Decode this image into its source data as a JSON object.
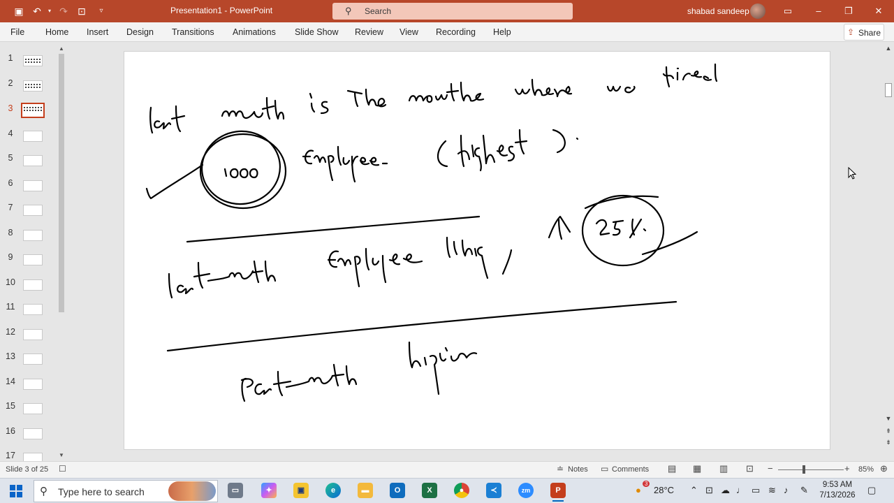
{
  "titlebar": {
    "doc_title": "Presentation1  -  PowerPoint",
    "search_placeholder": "Search",
    "user_name": "shabad sandeep",
    "icons": [
      "save-icon",
      "undo-icon",
      "redo-icon",
      "present-from-start-icon",
      "customize-qat-icon"
    ],
    "window_controls": [
      "ribbon-display-icon",
      "minimize-icon",
      "restore-icon",
      "close-icon"
    ]
  },
  "menu": {
    "items": [
      "File",
      "Home",
      "Insert",
      "Design",
      "Transitions",
      "Animations",
      "Slide Show",
      "Review",
      "View",
      "Recording",
      "Help"
    ],
    "share_label": "Share"
  },
  "thumbnails": {
    "numbers": [
      "1",
      "2",
      "3",
      "4",
      "5",
      "6",
      "7",
      "8",
      "9",
      "10",
      "11",
      "12",
      "13",
      "14",
      "15",
      "16",
      "17"
    ],
    "active_index": 3
  },
  "statusbar": {
    "slide_counter": "Slide 3 of 25",
    "notes_label": "Notes",
    "comments_label": "Comments",
    "zoom_minus": "−",
    "zoom_plus": "+",
    "zoom_level": "85%"
  },
  "taskbar": {
    "search_placeholder": "Type here to search",
    "weather_temp": "28°C",
    "weather_badge": "3",
    "time": "9:53 AM",
    "date": "7/13/2026",
    "apps": [
      "task-view-icon",
      "copilot-icon",
      "sticky-app-icon",
      "edge-icon",
      "file-explorer-icon",
      "outlook-icon",
      "excel-icon",
      "chrome-icon",
      "vscode-icon",
      "zoom-icon",
      "powerpoint-icon"
    ]
  },
  "colors": {
    "brand": "#b7472a",
    "accent_active": "#c43e1c",
    "menu_bg": "#f3f3f3",
    "workspace_bg": "#e6e6e6",
    "ink": "#000000"
  }
}
